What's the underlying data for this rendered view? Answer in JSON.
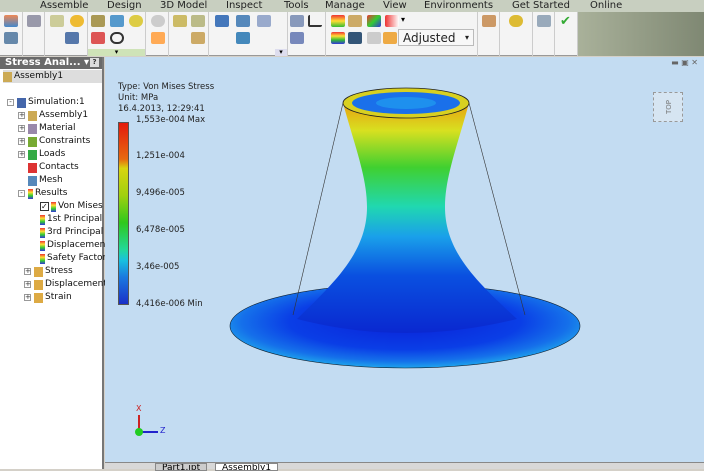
{
  "menu": [
    "Assemble",
    "Design",
    "3D Model",
    "Inspect",
    "Tools",
    "Manage",
    "View",
    "Environments",
    "Get Started",
    "Online"
  ],
  "ribbon": {
    "display_mode": "Adjusted"
  },
  "panel": {
    "title": "Stress Anal...",
    "help": "?",
    "root": "Assembly1",
    "nodes": [
      {
        "label": "Simulation:1"
      },
      {
        "label": "Assembly1"
      },
      {
        "label": "Material"
      },
      {
        "label": "Constraints"
      },
      {
        "label": "Loads"
      },
      {
        "label": "Contacts"
      },
      {
        "label": "Mesh"
      },
      {
        "label": "Results"
      },
      {
        "label": "Von Mises"
      },
      {
        "label": "1st Principal"
      },
      {
        "label": "3rd Principal"
      },
      {
        "label": "Displacement"
      },
      {
        "label": "Safety Factor"
      },
      {
        "label": "Stress"
      },
      {
        "label": "Displacement"
      },
      {
        "label": "Strain"
      }
    ]
  },
  "legend": {
    "type": "Type: Von Mises Stress",
    "unit": "Unit: MPa",
    "date": "16.4.2013, 12:29:41",
    "labels": [
      "1,553e-004 Max",
      "1,251e-004",
      "9,496e-005",
      "6,478e-005",
      "3,46e-005",
      "4,416e-006 Min"
    ]
  },
  "viewcube": {
    "face": "TOP"
  },
  "axes": {
    "x": "X",
    "z": "Z"
  },
  "tabs": [
    "Part1.ipt",
    "Assembly1"
  ]
}
